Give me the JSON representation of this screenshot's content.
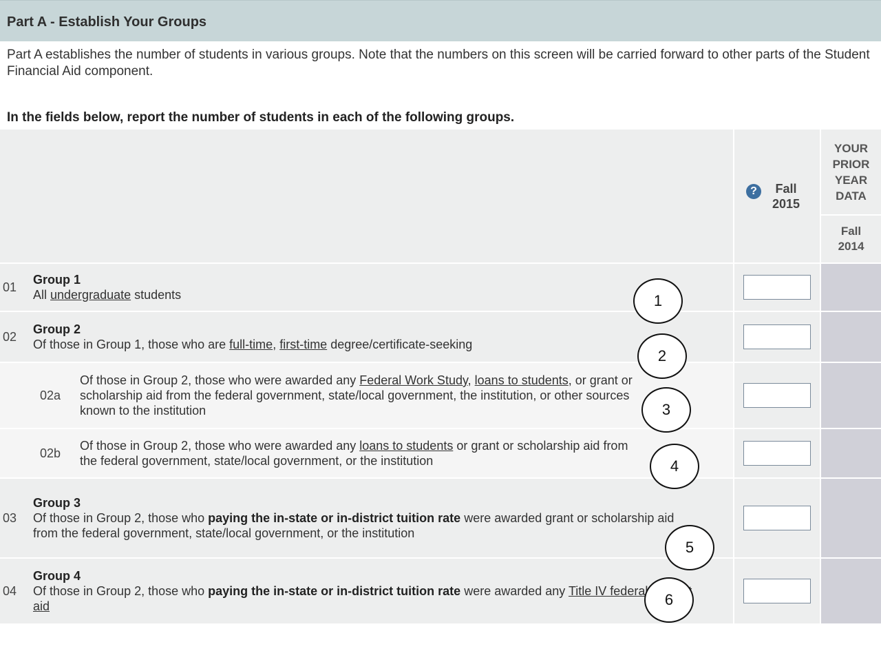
{
  "section": {
    "title": "Part A - Establish Your Groups",
    "intro": "Part A establishes the number of students in various groups. Note that the numbers on this screen will be carried forward to other parts of the Student Financial Aid component.",
    "instruction": "In the fields below, report the number of students in each of the following groups."
  },
  "columns": {
    "current": "Fall 2015",
    "prior_header": "YOUR PRIOR YEAR DATA",
    "prior": "Fall 2014"
  },
  "rows": [
    {
      "num": "01",
      "group": "Group 1",
      "t1": "All ",
      "l1": "undergraduate",
      "t2": " students"
    },
    {
      "num": "02",
      "group": "Group 2",
      "t1": "Of those in Group 1, those who are ",
      "l1": "full-time",
      "t2": ", ",
      "l2": "first-time",
      "t3": " degree/certificate-seeking"
    },
    {
      "num": "02a",
      "t1": "Of those in Group 2, those who were awarded any ",
      "l1": "Federal Work Study",
      "t2": ", ",
      "l2": "loans to students",
      "t3": ", or grant or scholarship aid from the federal government, state/local government, the institution, or other sources known to the institution"
    },
    {
      "num": "02b",
      "t1": "Of those in Group 2, those who were awarded any ",
      "l1": "loans to students",
      "t2": " or grant or scholarship aid from the federal government, state/local government, or the institution"
    },
    {
      "num": "03",
      "group": "Group 3",
      "t1": "Of those in Group 2, those who ",
      "b1": "paying the in-state or in-district tuition rate",
      "t2": " were awarded grant or scholarship aid from the federal government, state/local government, or the institution"
    },
    {
      "num": "04",
      "group": "Group 4",
      "t1": "Of those in Group 2, those who ",
      "b1": "paying the in-state or in-district tuition rate",
      "t2": " were awarded any ",
      "l1": "Title IV federal student aid"
    }
  ],
  "callouts": [
    "1",
    "2",
    "3",
    "4",
    "5",
    "6"
  ],
  "icons": {
    "help": "help-icon"
  },
  "colors": {
    "header_bg": "#c7d6d8",
    "row_bg": "#edeeee",
    "prior_bg": "#d0d0d8",
    "help_icon": "#3d6fa0"
  }
}
